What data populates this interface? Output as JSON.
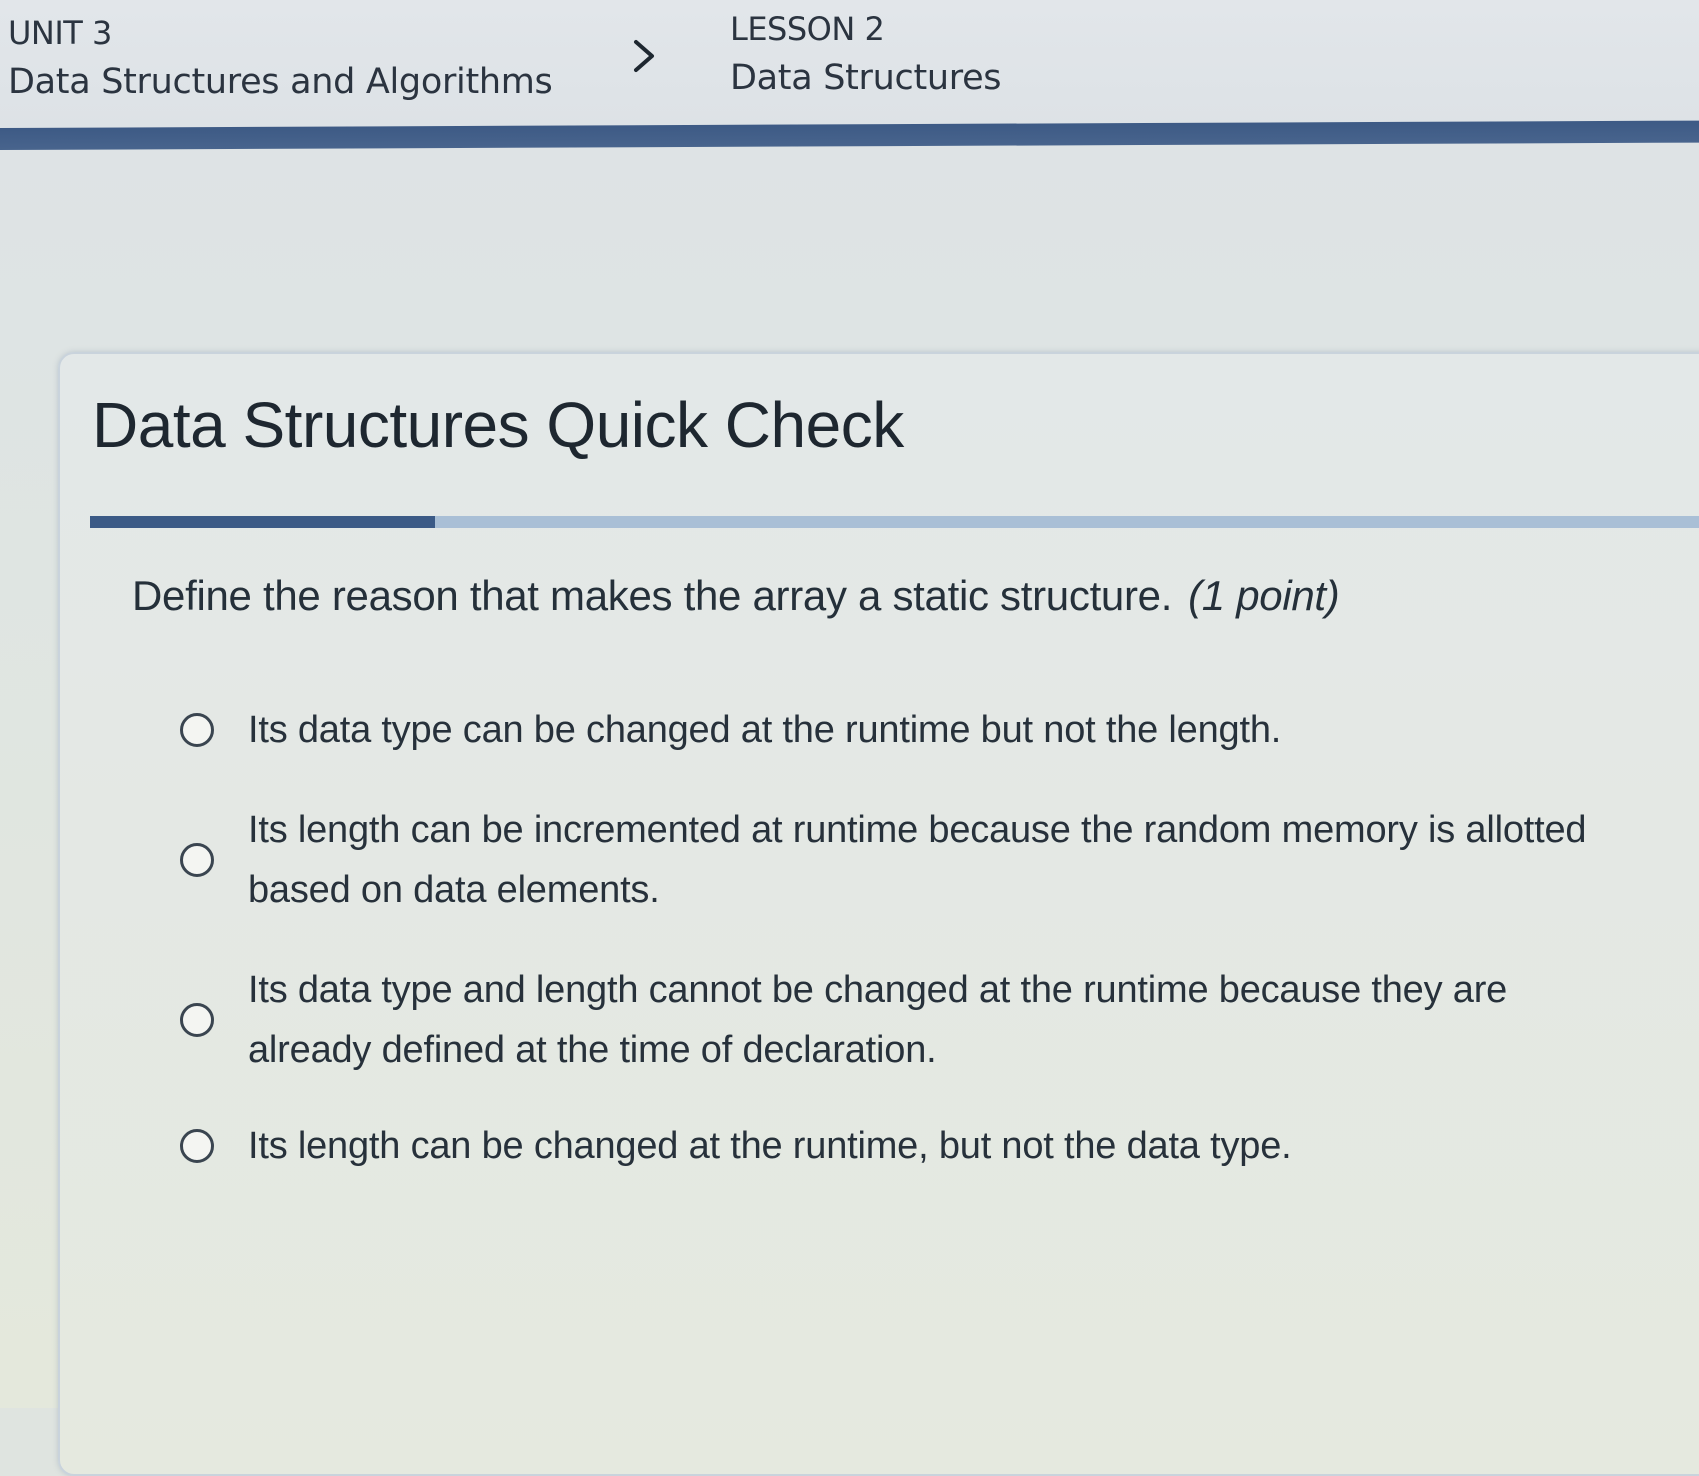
{
  "breadcrumb": {
    "unit_label": "UNIT 3",
    "unit_title": "Data Structures and Algorithms",
    "lesson_label": "LESSON 2",
    "lesson_title": "Data Structures"
  },
  "quiz": {
    "title": "Data Structures Quick Check",
    "question": "Define the reason that makes the array a static structure.",
    "points": "(1 point)",
    "options": [
      {
        "label": "Its data type can be changed at the runtime but not the length."
      },
      {
        "label": "Its length can be incremented at runtime because the random memory is allotted based on data elements."
      },
      {
        "label": "Its data type and length cannot be changed at the runtime because they are already defined at the time of declaration."
      },
      {
        "label": "Its length can be changed at the runtime, but not the data type."
      }
    ]
  },
  "colors": {
    "accent": "#3b5a86",
    "header_bar": "#3d5a85",
    "rule_light": "#a9bfd6",
    "text": "#1f2a33"
  },
  "icons": {
    "breadcrumb_separator": "chevron-right-icon",
    "option_marker": "radio-button-icon"
  }
}
